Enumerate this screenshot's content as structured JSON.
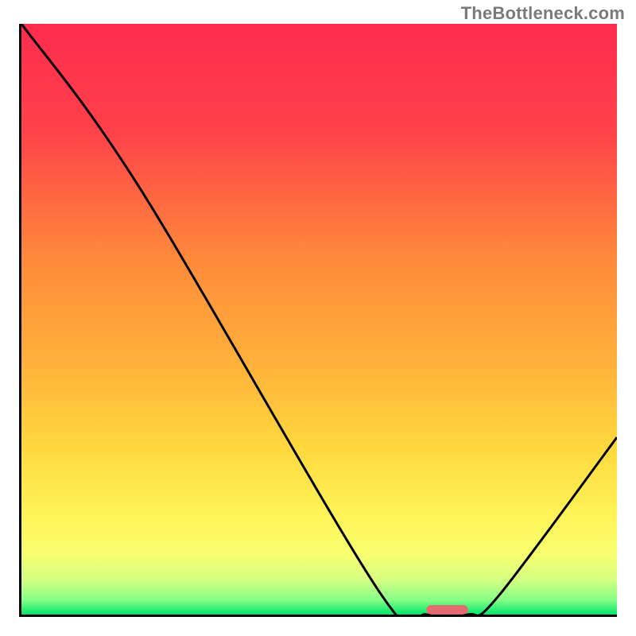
{
  "watermark": "TheBottleneck.com",
  "chart_data": {
    "type": "line",
    "title": "",
    "xlabel": "",
    "ylabel": "",
    "xlim": [
      0,
      100
    ],
    "ylim": [
      0,
      100
    ],
    "grid": false,
    "legend": false,
    "series": [
      {
        "name": "bottleneck-curve",
        "x": [
          0,
          20,
          60,
          68,
          75,
          80,
          100
        ],
        "values": [
          100,
          72,
          4,
          0,
          0,
          3,
          30
        ]
      }
    ],
    "marker": {
      "name": "optimal-range",
      "x_start": 68,
      "x_end": 75,
      "y": 0,
      "color": "#e46a6f"
    },
    "gradient_stops": [
      {
        "offset": 0.0,
        "color": "#ff2b4e"
      },
      {
        "offset": 0.18,
        "color": "#ff414a"
      },
      {
        "offset": 0.4,
        "color": "#ff8a3a"
      },
      {
        "offset": 0.58,
        "color": "#ffb23a"
      },
      {
        "offset": 0.72,
        "color": "#ffd93e"
      },
      {
        "offset": 0.84,
        "color": "#fff55a"
      },
      {
        "offset": 0.9,
        "color": "#f7ff70"
      },
      {
        "offset": 0.94,
        "color": "#d6ff82"
      },
      {
        "offset": 0.975,
        "color": "#87ff87"
      },
      {
        "offset": 1.0,
        "color": "#00e66a"
      }
    ]
  }
}
